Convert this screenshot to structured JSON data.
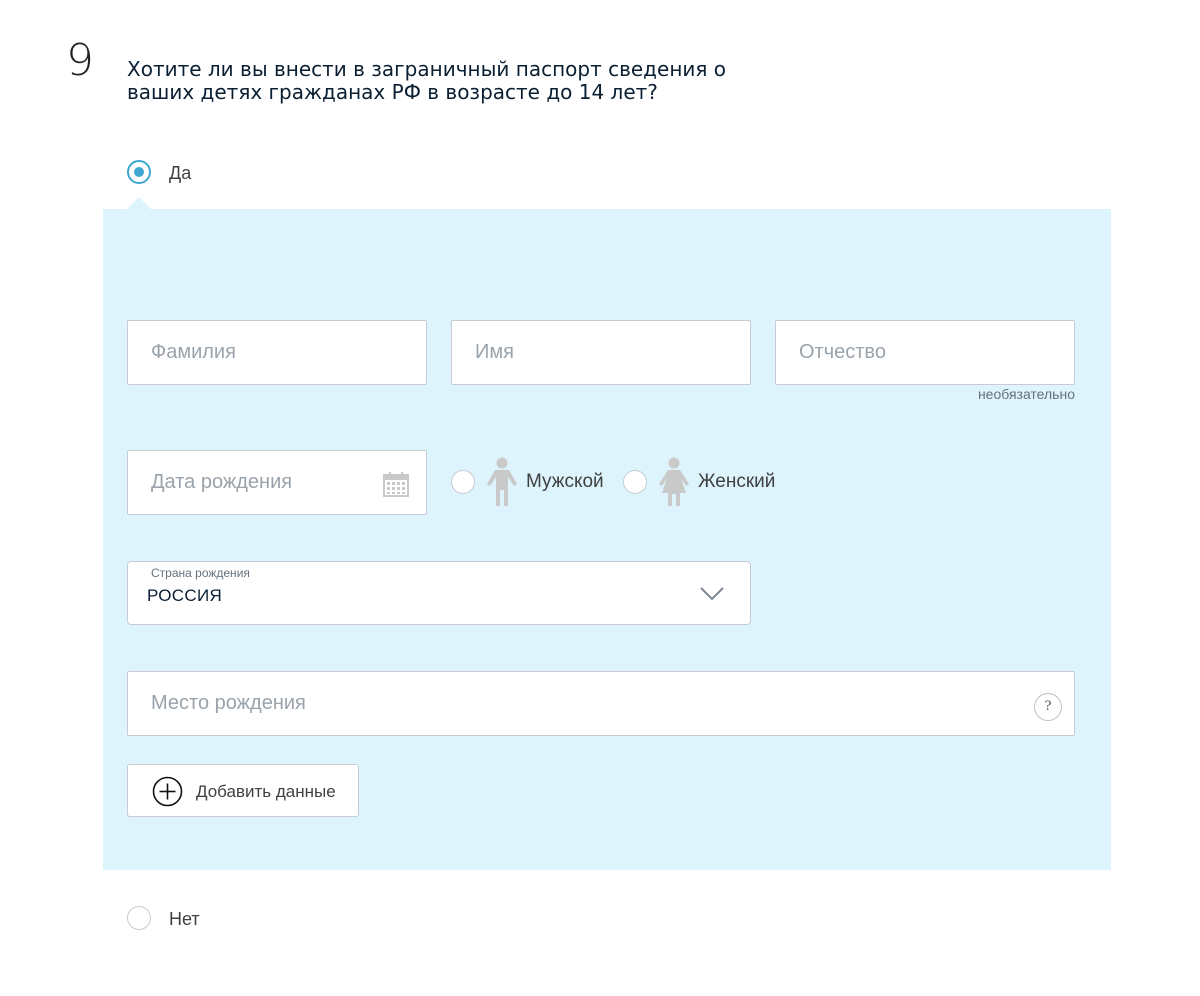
{
  "question": {
    "number": "9",
    "text": "Хотите ли вы внести в заграничный паспорт сведения о ваших детях гражданах РФ в возрасте до 14 лет?"
  },
  "options": {
    "yes": {
      "label": "Да",
      "checked": true
    },
    "no": {
      "label": "Нет",
      "checked": false
    }
  },
  "form": {
    "last_name": {
      "placeholder": "Фамилия",
      "value": ""
    },
    "first_name": {
      "placeholder": "Имя",
      "value": ""
    },
    "patronymic": {
      "placeholder": "Отчество",
      "value": "",
      "hint": "необязательно"
    },
    "birth_date": {
      "placeholder": "Дата рождения",
      "value": "",
      "icon": "calendar-icon"
    },
    "gender": {
      "male": {
        "label": "Мужской",
        "icon": "male-person-icon",
        "checked": false
      },
      "female": {
        "label": "Женский",
        "icon": "female-person-icon",
        "checked": false
      }
    },
    "birth_country": {
      "caption": "Страна рождения",
      "value": "РОССИЯ",
      "icon": "chevron-down-icon"
    },
    "birth_place": {
      "placeholder": "Место рождения",
      "value": "",
      "help_icon": "?"
    },
    "add_button": {
      "label": "Добавить данные",
      "icon": "plus-circle-icon"
    }
  },
  "colors": {
    "accent": "#3ea6d0",
    "panel_bg": "#ddf4fd",
    "field_border": "#c6ccd2",
    "placeholder": "#9aa3ab",
    "icon_gray": "#c9c9c9"
  }
}
